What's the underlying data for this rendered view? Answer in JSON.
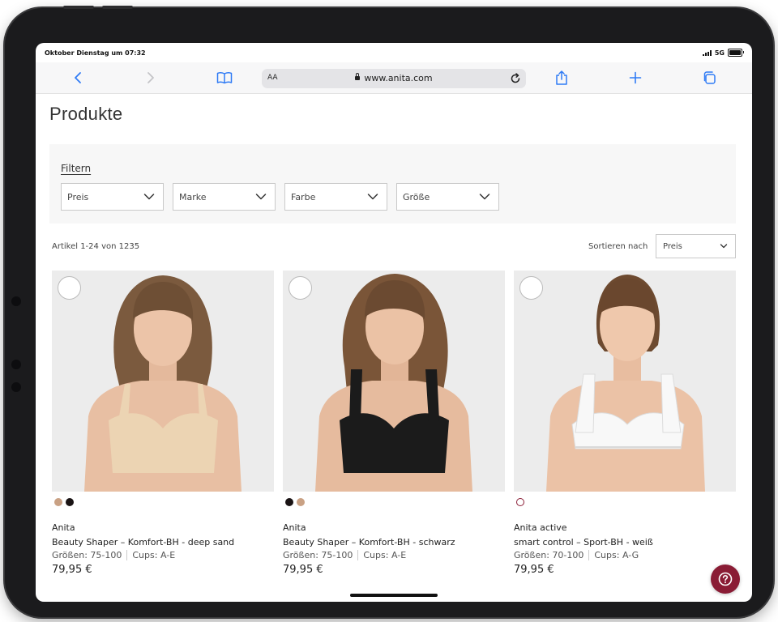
{
  "status_bar": {
    "time": "Oktober Dienstag um 07:32",
    "network": "5G"
  },
  "browser": {
    "text_size_label": "AA",
    "url": "www.anita.com"
  },
  "page": {
    "title": "Produkte",
    "filter_label": "Filtern",
    "filters": [
      {
        "label": "Preis"
      },
      {
        "label": "Marke"
      },
      {
        "label": "Farbe"
      },
      {
        "label": "Größe"
      }
    ],
    "article_count": "Artikel 1-24 von 1235",
    "sort_label": "Sortieren nach",
    "sort_value": "Preis"
  },
  "products": [
    {
      "brand": "Anita",
      "name": "Beauty Shaper – Komfort-BH - deep sand",
      "sizes": "Größen: 75-100",
      "cups": "Cups: A-E",
      "price": "79,95 €",
      "bra_color": "#ecd4b3",
      "swatch_colors": [
        "#c9a184",
        "#1a1314"
      ]
    },
    {
      "brand": "Anita",
      "name": "Beauty Shaper – Komfort-BH - schwarz",
      "sizes": "Größen: 75-100",
      "cups": "Cups: A-E",
      "price": "79,95 €",
      "bra_color": "#1b1b1b",
      "swatch_colors": [
        "#1a1314",
        "#c9a184"
      ]
    },
    {
      "brand": "Anita active",
      "name": "smart control – Sport-BH - weiß",
      "sizes": "Größen: 70-100",
      "cups": "Cups: A-G",
      "price": "79,95 €",
      "bra_color": "#f8f8f8",
      "swatch_colors": [
        "#ffffff"
      ]
    }
  ],
  "colors": {
    "accent_blue": "#2f7bf5",
    "help_button": "#8a1c35"
  }
}
